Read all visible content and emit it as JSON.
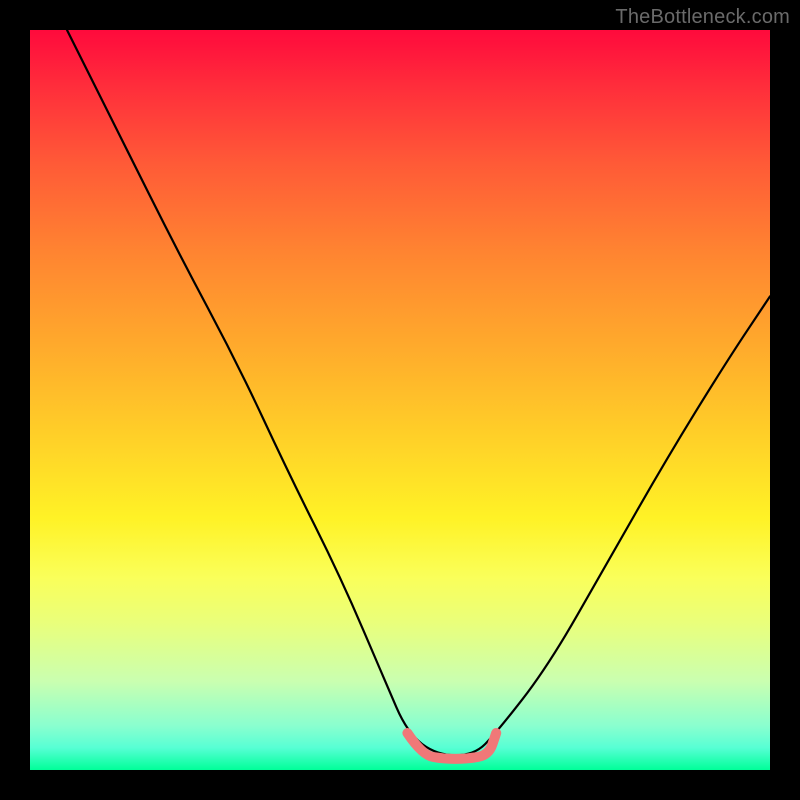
{
  "watermark": "TheBottleneck.com",
  "chart_data": {
    "type": "line",
    "title": "",
    "xlabel": "",
    "ylabel": "",
    "xlim": [
      0,
      1
    ],
    "ylim": [
      0,
      1
    ],
    "grid": false,
    "legend": false,
    "series": [
      {
        "name": "bottleneck-curve",
        "color": "#000000",
        "x": [
          0.05,
          0.12,
          0.2,
          0.28,
          0.35,
          0.42,
          0.48,
          0.51,
          0.55,
          0.6,
          0.63,
          0.7,
          0.78,
          0.86,
          0.94,
          1.0
        ],
        "values": [
          1.0,
          0.86,
          0.7,
          0.55,
          0.4,
          0.26,
          0.12,
          0.05,
          0.02,
          0.02,
          0.05,
          0.14,
          0.28,
          0.42,
          0.55,
          0.64
        ]
      },
      {
        "name": "optimal-band",
        "color": "#f07878",
        "x": [
          0.51,
          0.53,
          0.56,
          0.59,
          0.62,
          0.63
        ],
        "values": [
          0.05,
          0.02,
          0.015,
          0.015,
          0.02,
          0.05
        ]
      }
    ],
    "background_gradient": {
      "top": "#ff0a3c",
      "middle": "#fff226",
      "bottom": "#00ff99"
    }
  }
}
